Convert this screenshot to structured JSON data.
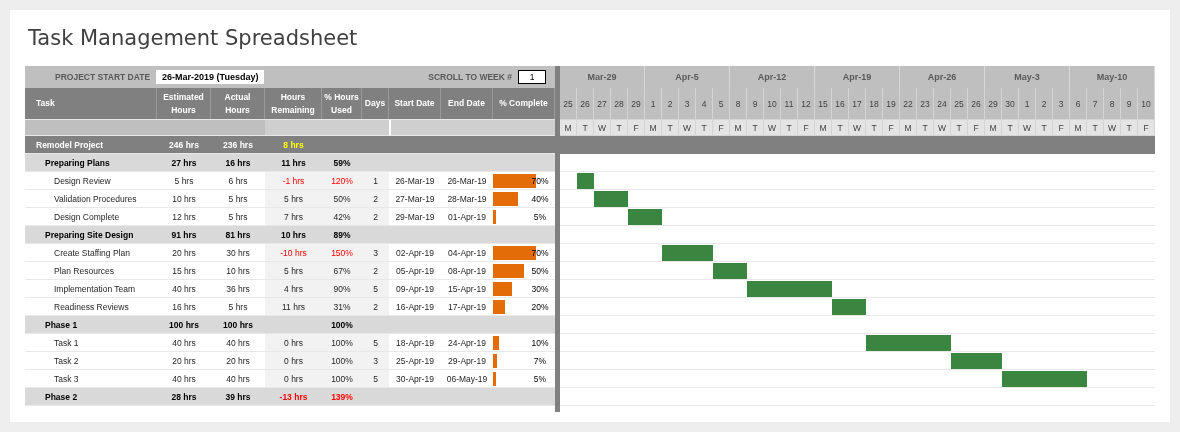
{
  "title": "Task Management Spreadsheet",
  "settings": {
    "start_label": "PROJECT START DATE",
    "start_value": "26-Mar-2019 (Tuesday)",
    "scroll_label": "SCROLL TO WEEK #",
    "scroll_value": "1"
  },
  "columns": [
    {
      "label": "Task"
    },
    {
      "label": "Estimated Hours"
    },
    {
      "label": "Actual Hours"
    },
    {
      "label": "Hours Remaining"
    },
    {
      "label": "% Hours Used"
    },
    {
      "label": "Days"
    },
    {
      "label": "Start Date"
    },
    {
      "label": "End Date"
    },
    {
      "label": "% Complete"
    }
  ],
  "rows": [
    {
      "kind": "summary",
      "task": "Remodel Project",
      "estimated": "246 hrs",
      "actual": "236 hrs",
      "remaining": "8 hrs",
      "over_budget": false
    },
    {
      "kind": "group",
      "task": "Preparing Plans",
      "estimated": "27 hrs",
      "actual": "16 hrs",
      "remaining": "11 hrs",
      "used": "59%",
      "over_budget": false
    },
    {
      "kind": "task",
      "task": "Design Review",
      "estimated": "5 hrs",
      "actual": "6 hrs",
      "remaining": "-1 hrs",
      "used": "120%",
      "days": "1",
      "start": "26-Mar-19",
      "end": "26-Mar-19",
      "complete": "70%",
      "level": 0.7,
      "over_budget": true
    },
    {
      "kind": "task",
      "task": "Validation Procedures",
      "estimated": "10 hrs",
      "actual": "5 hrs",
      "remaining": "5 hrs",
      "used": "50%",
      "days": "2",
      "start": "27-Mar-19",
      "end": "28-Mar-19",
      "complete": "40%",
      "level": 0.4,
      "over_budget": false
    },
    {
      "kind": "task",
      "task": "Design Complete",
      "estimated": "12 hrs",
      "actual": "5 hrs",
      "remaining": "7 hrs",
      "used": "42%",
      "days": "2",
      "start": "29-Mar-19",
      "end": "01-Apr-19",
      "complete": "5%",
      "level": 0.05,
      "over_budget": false
    },
    {
      "kind": "group",
      "task": "Preparing Site Design",
      "estimated": "91 hrs",
      "actual": "81 hrs",
      "remaining": "10 hrs",
      "used": "89%",
      "over_budget": false
    },
    {
      "kind": "task",
      "task": "Create Staffing Plan",
      "estimated": "20 hrs",
      "actual": "30 hrs",
      "remaining": "-10 hrs",
      "used": "150%",
      "days": "3",
      "start": "02-Apr-19",
      "end": "04-Apr-19",
      "complete": "70%",
      "level": 0.7,
      "over_budget": true
    },
    {
      "kind": "task",
      "task": "Plan Resources",
      "estimated": "15 hrs",
      "actual": "10 hrs",
      "remaining": "5 hrs",
      "used": "67%",
      "days": "2",
      "start": "05-Apr-19",
      "end": "08-Apr-19",
      "complete": "50%",
      "level": 0.5,
      "over_budget": false
    },
    {
      "kind": "task",
      "task": "Implementation Team",
      "estimated": "40 hrs",
      "actual": "36 hrs",
      "remaining": "4 hrs",
      "used": "90%",
      "days": "5",
      "start": "09-Apr-19",
      "end": "15-Apr-19",
      "complete": "30%",
      "level": 0.3,
      "over_budget": false
    },
    {
      "kind": "task",
      "task": "Readiness Reviews",
      "estimated": "16 hrs",
      "actual": "5 hrs",
      "remaining": "11 hrs",
      "used": "31%",
      "days": "2",
      "start": "16-Apr-19",
      "end": "17-Apr-19",
      "complete": "20%",
      "level": 0.2,
      "over_budget": false
    },
    {
      "kind": "group",
      "task": "Phase 1",
      "estimated": "100 hrs",
      "actual": "100 hrs",
      "used": "100%",
      "over_budget": false
    },
    {
      "kind": "task",
      "task": "Task 1",
      "estimated": "40 hrs",
      "actual": "40 hrs",
      "remaining": "0 hrs",
      "used": "100%",
      "days": "5",
      "start": "18-Apr-19",
      "end": "24-Apr-19",
      "complete": "10%",
      "level": 0.1,
      "over_budget": false
    },
    {
      "kind": "task",
      "task": "Task 2",
      "estimated": "20 hrs",
      "actual": "20 hrs",
      "remaining": "0 hrs",
      "used": "100%",
      "days": "3",
      "start": "25-Apr-19",
      "end": "29-Apr-19",
      "complete": "7%",
      "level": 0.07,
      "over_budget": false
    },
    {
      "kind": "task",
      "task": "Task 3",
      "estimated": "40 hrs",
      "actual": "40 hrs",
      "remaining": "0 hrs",
      "used": "100%",
      "days": "5",
      "start": "30-Apr-19",
      "end": "06-May-19",
      "complete": "5%",
      "level": 0.05,
      "over_budget": false
    },
    {
      "kind": "group",
      "task": "Phase 2",
      "estimated": "28 hrs",
      "actual": "39 hrs",
      "remaining": "-13 hrs",
      "used": "139%",
      "over_budget": true
    }
  ],
  "weeks": [
    {
      "label": "Mar-29",
      "days": [
        {
          "number": "25",
          "weekday": "M"
        },
        {
          "number": "26",
          "weekday": "T"
        },
        {
          "number": "27",
          "weekday": "W"
        },
        {
          "number": "28",
          "weekday": "T"
        },
        {
          "number": "29",
          "weekday": "F"
        }
      ]
    },
    {
      "label": "Apr-5",
      "days": [
        {
          "number": "1",
          "weekday": "M"
        },
        {
          "number": "2",
          "weekday": "T"
        },
        {
          "number": "3",
          "weekday": "W"
        },
        {
          "number": "4",
          "weekday": "T"
        },
        {
          "number": "5",
          "weekday": "F"
        }
      ]
    },
    {
      "label": "Apr-12",
      "days": [
        {
          "number": "8",
          "weekday": "M"
        },
        {
          "number": "9",
          "weekday": "T"
        },
        {
          "number": "10",
          "weekday": "W"
        },
        {
          "number": "11",
          "weekday": "T"
        },
        {
          "number": "12",
          "weekday": "F"
        }
      ]
    },
    {
      "label": "Apr-19",
      "days": [
        {
          "number": "15",
          "weekday": "M"
        },
        {
          "number": "16",
          "weekday": "T"
        },
        {
          "number": "17",
          "weekday": "W"
        },
        {
          "number": "18",
          "weekday": "T"
        },
        {
          "number": "19",
          "weekday": "F"
        }
      ]
    },
    {
      "label": "Apr-26",
      "days": [
        {
          "number": "22",
          "weekday": "M"
        },
        {
          "number": "23",
          "weekday": "T"
        },
        {
          "number": "24",
          "weekday": "W"
        },
        {
          "number": "25",
          "weekday": "T"
        },
        {
          "number": "26",
          "weekday": "F"
        }
      ]
    },
    {
      "label": "May-3",
      "days": [
        {
          "number": "29",
          "weekday": "M"
        },
        {
          "number": "30",
          "weekday": "T"
        },
        {
          "number": "1",
          "weekday": "W"
        },
        {
          "number": "2",
          "weekday": "T"
        },
        {
          "number": "3",
          "weekday": "F"
        }
      ]
    },
    {
      "label": "May-10",
      "days": [
        {
          "number": "6",
          "weekday": "M"
        },
        {
          "number": "7",
          "weekday": "T"
        },
        {
          "number": "8",
          "weekday": "W"
        },
        {
          "number": "9",
          "weekday": "T"
        },
        {
          "number": "10",
          "weekday": "F"
        }
      ]
    }
  ]
}
